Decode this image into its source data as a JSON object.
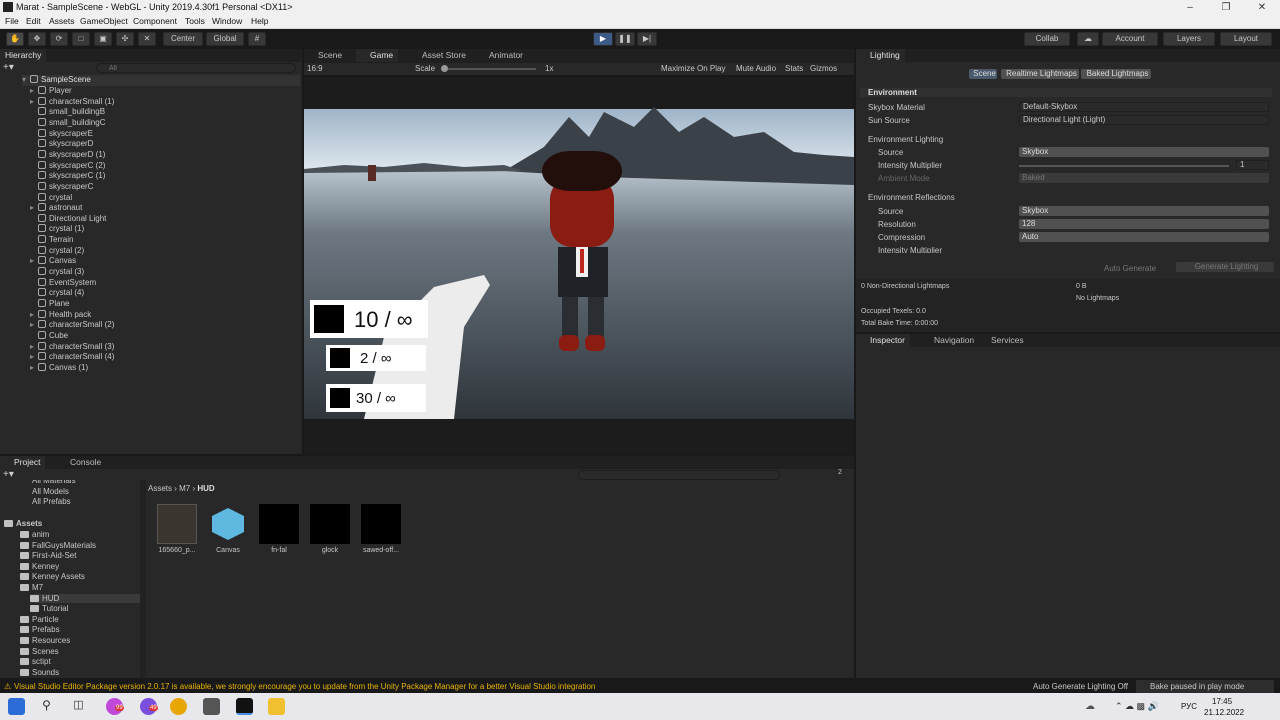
{
  "window": {
    "title": "Marat - SampleScene - WebGL - Unity 2019.4.30f1 Personal <DX11>"
  },
  "menu": [
    "File",
    "Edit",
    "Assets",
    "GameObject",
    "Component",
    "Tools",
    "Window",
    "Help"
  ],
  "toolbar": {
    "center": "Center",
    "global": "Global",
    "collab": "Collab",
    "account": "Account",
    "layers": "Layers",
    "layout": "Layout"
  },
  "hierarchy": {
    "tab": "Hierarchy",
    "search_placeholder": "All",
    "scene": "SampleScene",
    "items": [
      {
        "name": "Player",
        "expand": true
      },
      {
        "name": "characterSmall (1)",
        "expand": true
      },
      {
        "name": "small_buildingB",
        "expand": false
      },
      {
        "name": "small_buildingC",
        "expand": false
      },
      {
        "name": "skyscraperE",
        "expand": false
      },
      {
        "name": "skyscraperD",
        "expand": false
      },
      {
        "name": "skyscraperD (1)",
        "expand": false
      },
      {
        "name": "skyscraperC (2)",
        "expand": false
      },
      {
        "name": "skyscraperC (1)",
        "expand": false
      },
      {
        "name": "skyscraperC",
        "expand": false
      },
      {
        "name": "crystal",
        "expand": false
      },
      {
        "name": "astronaut",
        "expand": true
      },
      {
        "name": "Directional Light",
        "expand": false
      },
      {
        "name": "crystal (1)",
        "expand": false
      },
      {
        "name": "Terrain",
        "expand": false
      },
      {
        "name": "crystal (2)",
        "expand": false
      },
      {
        "name": "Canvas",
        "expand": true
      },
      {
        "name": "crystal (3)",
        "expand": false
      },
      {
        "name": "EventSystem",
        "expand": false
      },
      {
        "name": "crystal (4)",
        "expand": false
      },
      {
        "name": "Plane",
        "expand": false
      },
      {
        "name": "Health pack",
        "expand": true
      },
      {
        "name": "characterSmall (2)",
        "expand": true
      },
      {
        "name": "Cube",
        "expand": false
      },
      {
        "name": "characterSmall (3)",
        "expand": true
      },
      {
        "name": "characterSmall (4)",
        "expand": true
      },
      {
        "name": "Canvas (1)",
        "expand": true
      }
    ]
  },
  "center_tabs": {
    "scene": "Scene",
    "game": "Game",
    "asset_store": "Asset Store",
    "animator": "Animator"
  },
  "game_bar": {
    "aspect": "16:9",
    "scale_label": "Scale",
    "scale_value": "1x",
    "maximize": "Maximize On Play",
    "mute": "Mute Audio",
    "stats": "Stats",
    "gizmos": "Gizmos"
  },
  "hud": {
    "pistol": "10 / ∞",
    "rifle": "2 / ∞",
    "shotgun": "30 / ∞"
  },
  "lighting": {
    "tab": "Lighting",
    "modes": [
      "Scene",
      "Realtime Lightmaps",
      "Baked Lightmaps"
    ],
    "environment": "Environment",
    "skybox_material_label": "Skybox Material",
    "skybox_material_value": "Default-Skybox",
    "sun_source_label": "Sun Source",
    "sun_source_value": "Directional Light (Light)",
    "env_lighting": "Environment Lighting",
    "source_label": "Source",
    "source_value": "Skybox",
    "intensity_label": "Intensity Multiplier",
    "intensity_value": "1",
    "ambient_label": "Ambient Mode",
    "ambient_value": "Baked",
    "env_reflections": "Environment Reflections",
    "refl_source_label": "Source",
    "refl_source_value": "Skybox",
    "resolution_label": "Resolution",
    "resolution_value": "128",
    "compression_label": "Compression",
    "compression_value": "Auto",
    "refl_intensity_label": "Intensity Multiplier",
    "refl_intensity_value": "1",
    "auto_generate": "Auto Generate",
    "generate": "Generate Lighting",
    "non_dir": "0 Non-Directional Lightmaps",
    "size": "0 B",
    "no_lightmaps": "No Lightmaps",
    "texels": "Occupied Texels: 0.0",
    "bake_time": "Total Bake Time: 0:00:00"
  },
  "inspector_tabs": {
    "inspector": "Inspector",
    "navigation": "Navigation",
    "services": "Services"
  },
  "project": {
    "tab": "Project",
    "console": "Console",
    "breadcrumb": [
      "Assets",
      "M7",
      "HUD"
    ],
    "favorites": [
      "All Materials",
      "All Models",
      "All Prefabs"
    ],
    "assets_root": "Assets",
    "tree": [
      {
        "name": "anim",
        "indent": 1
      },
      {
        "name": "FallGuysMaterials",
        "indent": 1
      },
      {
        "name": "First-Aid-Set",
        "indent": 1
      },
      {
        "name": "Kenney",
        "indent": 1
      },
      {
        "name": "Kenney Assets",
        "indent": 1
      },
      {
        "name": "M7",
        "indent": 1
      },
      {
        "name": "HUD",
        "indent": 2
      },
      {
        "name": "Tutorial",
        "indent": 2
      },
      {
        "name": "Particle",
        "indent": 1
      },
      {
        "name": "Prefabs",
        "indent": 1
      },
      {
        "name": "Resources",
        "indent": 1
      },
      {
        "name": "Scenes",
        "indent": 1
      },
      {
        "name": "sctipt",
        "indent": 1
      },
      {
        "name": "Sounds",
        "indent": 1
      }
    ],
    "assets": [
      "165660_p...",
      "Canvas",
      "fn-fal",
      "glock",
      "sawed-off..."
    ],
    "hidden_count": "2"
  },
  "status": {
    "warning": "Visual Studio Editor Package version 2.0.17 is available, we strongly encourage you to update from the Unity Package Manager for a better Visual Studio integration",
    "auto_gen": "Auto Generate Lighting Off",
    "bake": "Bake paused in play mode"
  },
  "taskbar": {
    "time": "17:45",
    "date": "21.12.2022",
    "lang": "РУС",
    "badge1": "99",
    "badge2": "49"
  }
}
